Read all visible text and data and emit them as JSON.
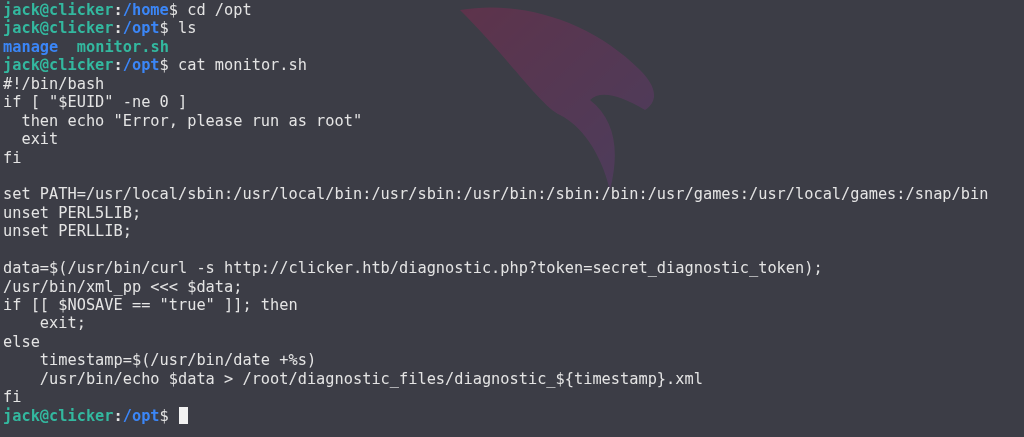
{
  "terminal": {
    "lines": [
      {
        "kind": "prompt",
        "host": "jack@clicker",
        "separator": ":",
        "path": "/home",
        "command": "$ cd /opt"
      },
      {
        "kind": "prompt",
        "host": "jack@clicker",
        "separator": ":",
        "path": "/opt",
        "command": "$ ls"
      },
      {
        "kind": "listing",
        "entries": [
          {
            "text": "manage",
            "color": "#3b86f7"
          },
          {
            "text": "monitor.sh",
            "color": "#33b89f"
          }
        ]
      },
      {
        "kind": "prompt",
        "host": "jack@clicker",
        "separator": ":",
        "path": "/opt",
        "command": "$ cat monitor.sh"
      },
      {
        "kind": "text",
        "text": "#!/bin/bash"
      },
      {
        "kind": "text",
        "text": "if [ \"$EUID\" -ne 0 ]"
      },
      {
        "kind": "text",
        "text": "  then echo \"Error, please run as root\""
      },
      {
        "kind": "text",
        "text": "  exit"
      },
      {
        "kind": "text",
        "text": "fi"
      },
      {
        "kind": "blank"
      },
      {
        "kind": "text",
        "text": "set PATH=/usr/local/sbin:/usr/local/bin:/usr/sbin:/usr/bin:/sbin:/bin:/usr/games:/usr/local/games:/snap/bin"
      },
      {
        "kind": "text",
        "text": "unset PERL5LIB;"
      },
      {
        "kind": "text",
        "text": "unset PERLLIB;"
      },
      {
        "kind": "blank"
      },
      {
        "kind": "text",
        "text": "data=$(/usr/bin/curl -s http://clicker.htb/diagnostic.php?token=secret_diagnostic_token);"
      },
      {
        "kind": "text",
        "text": "/usr/bin/xml_pp <<< $data;"
      },
      {
        "kind": "text",
        "text": "if [[ $NOSAVE == \"true\" ]]; then"
      },
      {
        "kind": "text",
        "text": "    exit;"
      },
      {
        "kind": "text",
        "text": "else"
      },
      {
        "kind": "text",
        "text": "    timestamp=$(/usr/bin/date +%s)"
      },
      {
        "kind": "text",
        "text": "    /usr/bin/echo $data > /root/diagnostic_files/diagnostic_${timestamp}.xml"
      },
      {
        "kind": "text",
        "text": "fi"
      },
      {
        "kind": "prompt",
        "host": "jack@clicker",
        "separator": ":",
        "path": "/opt",
        "command": "$ ",
        "cursor": true
      }
    ]
  }
}
